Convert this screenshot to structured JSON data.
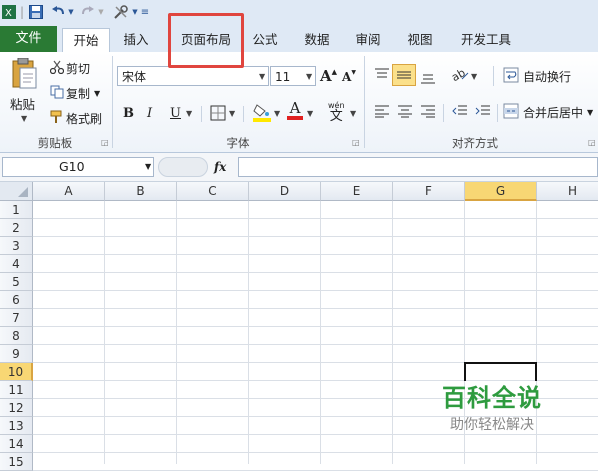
{
  "tabs": {
    "file": "文件",
    "items": [
      "开始",
      "插入",
      "页面布局",
      "公式",
      "数据",
      "审阅",
      "视图",
      "开发工具"
    ]
  },
  "clipboard": {
    "paste": "粘贴",
    "cut": "剪切",
    "copy": "复制",
    "format_painter": "格式刷",
    "group_label": "剪贴板"
  },
  "font": {
    "name": "宋体",
    "size": "11",
    "bold": "B",
    "italic": "I",
    "underline": "U",
    "grow": "A",
    "shrink": "A",
    "font_color_letter": "A",
    "phonetic": "wén",
    "phonetic_char": "文",
    "group_label": "字体"
  },
  "alignment": {
    "wrap_text": "自动换行",
    "merge_center": "合并后居中",
    "group_label": "对齐方式"
  },
  "formula_bar": {
    "name_box": "G10",
    "fx": "fx"
  },
  "grid": {
    "columns": [
      "A",
      "B",
      "C",
      "D",
      "E",
      "F",
      "G",
      "H"
    ],
    "rows": [
      "1",
      "2",
      "3",
      "4",
      "5",
      "6",
      "7",
      "8",
      "9",
      "10",
      "11",
      "12",
      "13",
      "14",
      "15"
    ],
    "selected_column": "G",
    "selected_row": "10"
  },
  "watermark": {
    "title": "百科全说",
    "subtitle": "助你轻松解决"
  },
  "colors": {
    "file_tab": "#2a7a34",
    "highlight_box": "#e0453e",
    "selection": "#f8d774",
    "watermark_green": "#2e9b3f"
  }
}
